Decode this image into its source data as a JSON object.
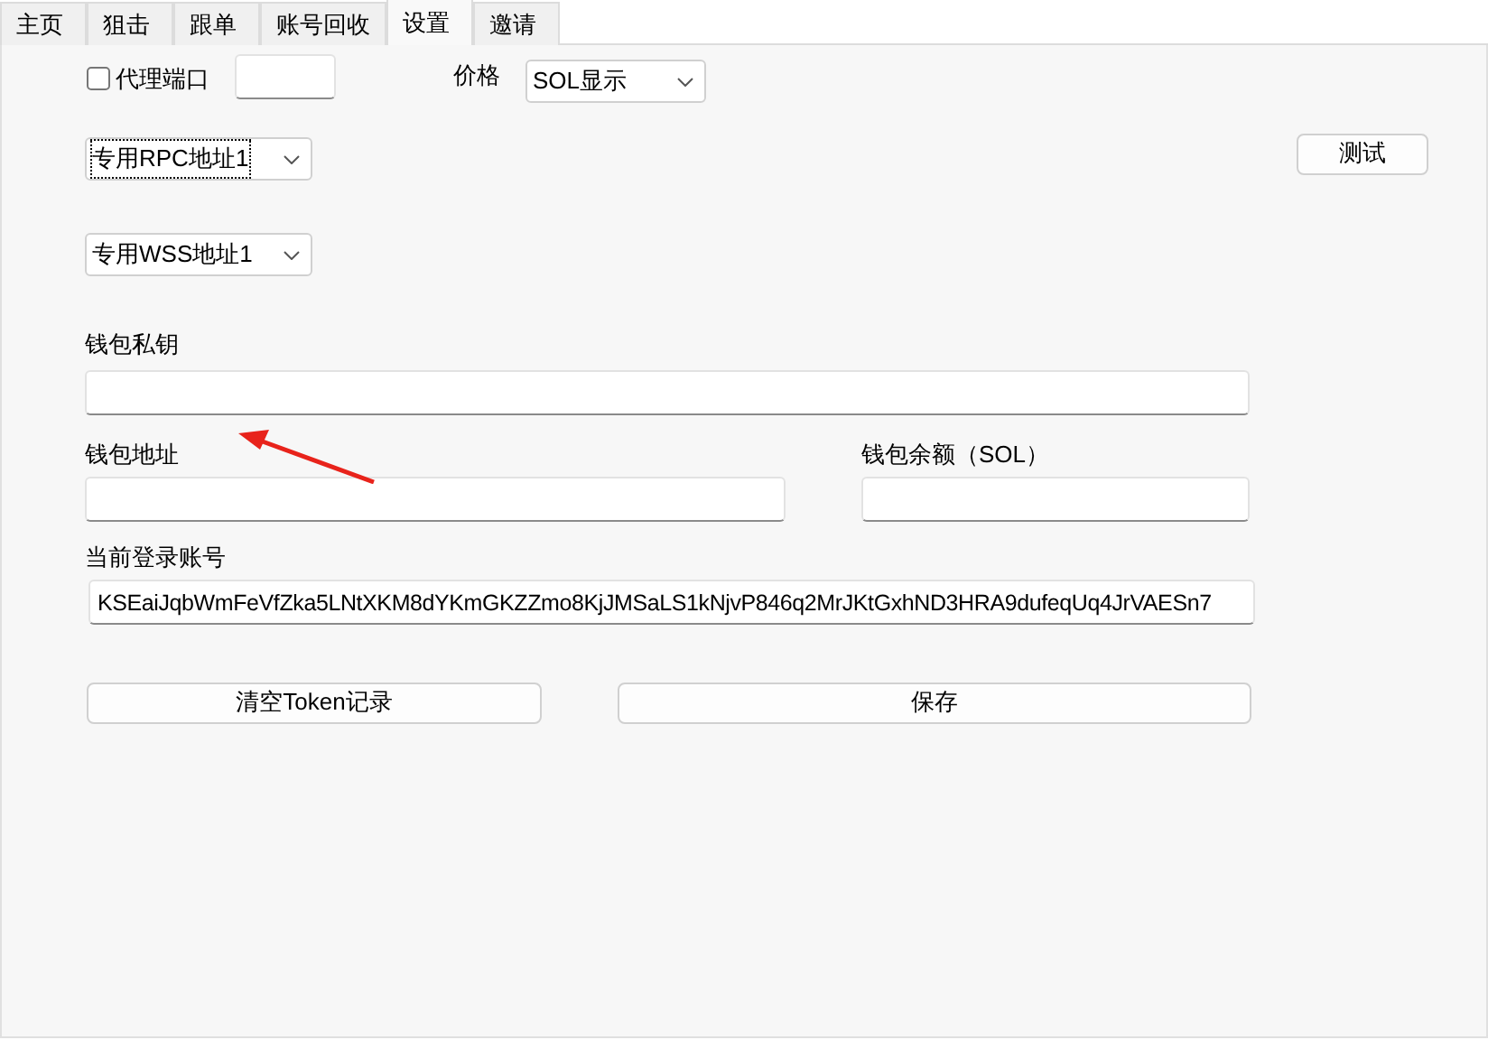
{
  "tabs": [
    {
      "label": "主页",
      "selected": false
    },
    {
      "label": "狙击",
      "selected": false
    },
    {
      "label": "跟单",
      "selected": false
    },
    {
      "label": "账号回收",
      "selected": false
    },
    {
      "label": "设置",
      "selected": true
    },
    {
      "label": "邀请",
      "selected": false
    }
  ],
  "proxy_port": {
    "label": "代理端口",
    "checked": false
  },
  "price": {
    "label": "价格",
    "value": "SOL显示"
  },
  "rpc_select": {
    "value": "专用RPC地址1",
    "focused": true
  },
  "test_button": "测试",
  "wss_select": {
    "value": "专用WSS地址1",
    "focused": false
  },
  "private_key": {
    "label": "钱包私钥"
  },
  "wallet_address": {
    "label": "钱包地址"
  },
  "balance": {
    "label": "钱包余额（SOL）"
  },
  "account": {
    "label": "当前登录账号",
    "value": "KSEaiJqbWmFeVfZka5LNtXKM8dYKmGKZZmo8KjJMSaLS1kNjvP846q2MrJKtGxhND3HRA9dufeqUq4JrVAESn7"
  },
  "buttons": [
    "清空Token记录",
    "保存"
  ]
}
